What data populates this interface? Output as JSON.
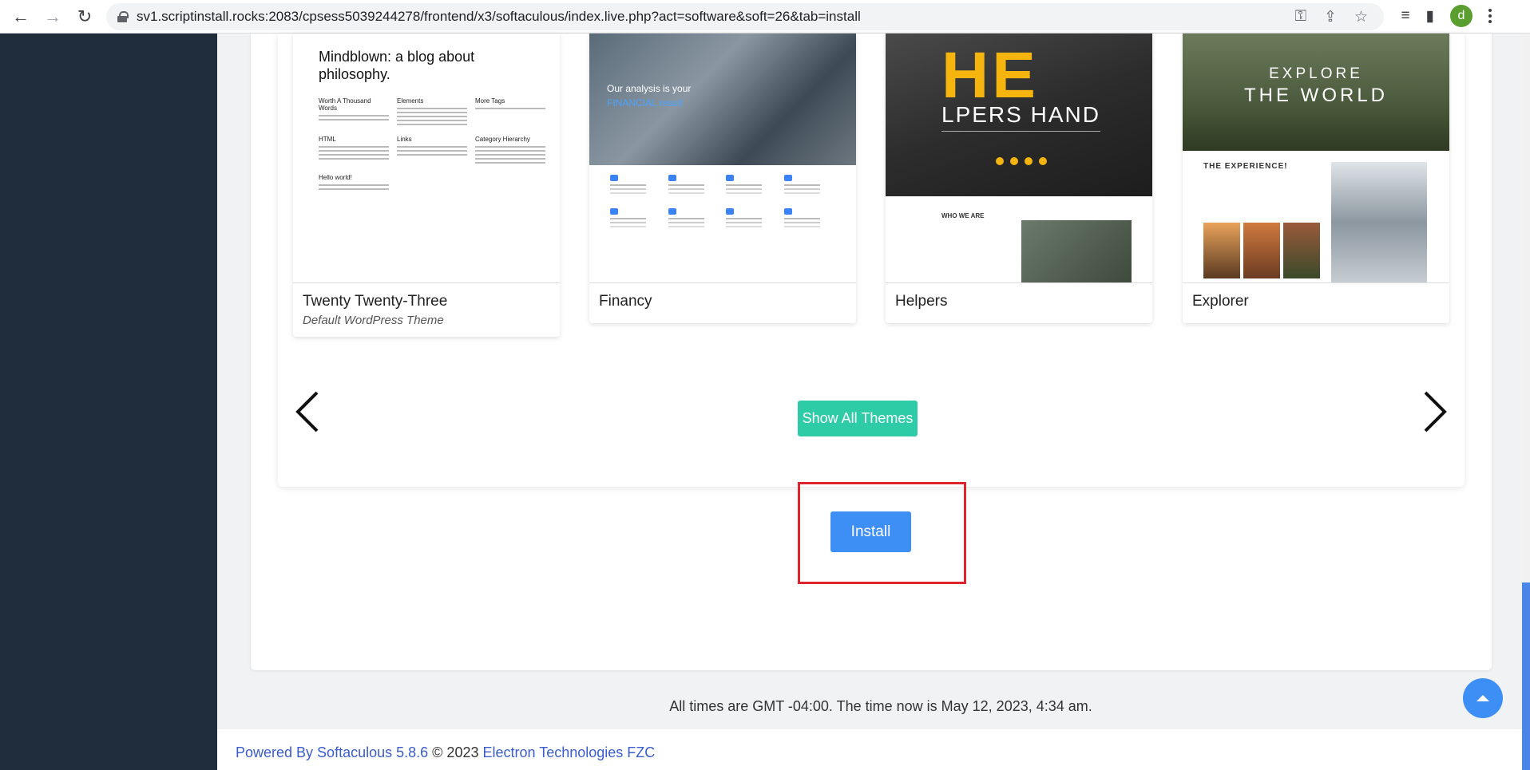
{
  "browser": {
    "url": "sv1.scriptinstall.rocks:2083/cpsess5039244278/frontend/x3/softaculous/index.live.php?act=software&soft=26&tab=install",
    "profile_initial": "d",
    "back_icon": "←",
    "forward_icon": "→",
    "reload_icon": "↻"
  },
  "themes": [
    {
      "name": "Twenty Twenty-Three",
      "description": "Default WordPress Theme",
      "preview": {
        "heading": "Mindblown: a blog about philosophy.",
        "columns": [
          "Worth A Thousand Words",
          "Elements",
          "More Tags",
          "HTML",
          "Links",
          "Category Hierarchy",
          "Hello world!"
        ]
      }
    },
    {
      "name": "Financy",
      "description": "",
      "preview": {
        "hero_text": "Our analysis is your",
        "hero_highlight": "FINANCIAL result"
      }
    },
    {
      "name": "Helpers",
      "description": "",
      "preview": {
        "hero_line1": "HE",
        "hero_line2": "LPERS HAND",
        "section_label": "WHO WE ARE"
      }
    },
    {
      "name": "Explorer",
      "description": "",
      "preview": {
        "hero_line1": "EXPLORE",
        "hero_line2": "THE WORLD",
        "section_label": "THE EXPERIENCE!"
      }
    }
  ],
  "carousel": {
    "show_all_label": "Show All Themes"
  },
  "install": {
    "button_label": "Install"
  },
  "time_note": "All times are GMT -04:00. The time now is May 12, 2023, 4:34 am.",
  "footer": {
    "powered_by": "Powered By Softaculous 5.8.6",
    "copyright": "© 2023",
    "company": "Electron Technologies FZC"
  },
  "colors": {
    "sidebar": "#1f2d3d",
    "show_all_button": "#2ecba7",
    "install_button": "#3d8ff6",
    "highlight_box": "#e0242f",
    "footer_link": "#3a5ccc"
  }
}
